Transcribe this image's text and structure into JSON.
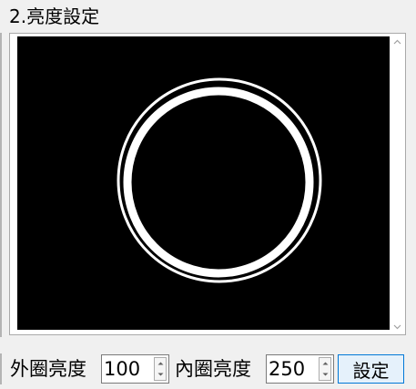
{
  "section": {
    "title": "2.亮度設定"
  },
  "preview": {
    "background_color": "#000000",
    "ring_color": "#ffffff",
    "scrollbar": {
      "up_icon": "chevron-up-icon",
      "down_icon": "chevron-down-icon"
    }
  },
  "controls": {
    "outer_label": "外圈亮度",
    "outer_value": "100",
    "inner_label": "內圈亮度",
    "inner_value": "250",
    "set_button": "設定"
  },
  "colors": {
    "accent": "#0078d7",
    "button_bg": "#e5f1fb",
    "window_bg": "#f0f0f0"
  }
}
